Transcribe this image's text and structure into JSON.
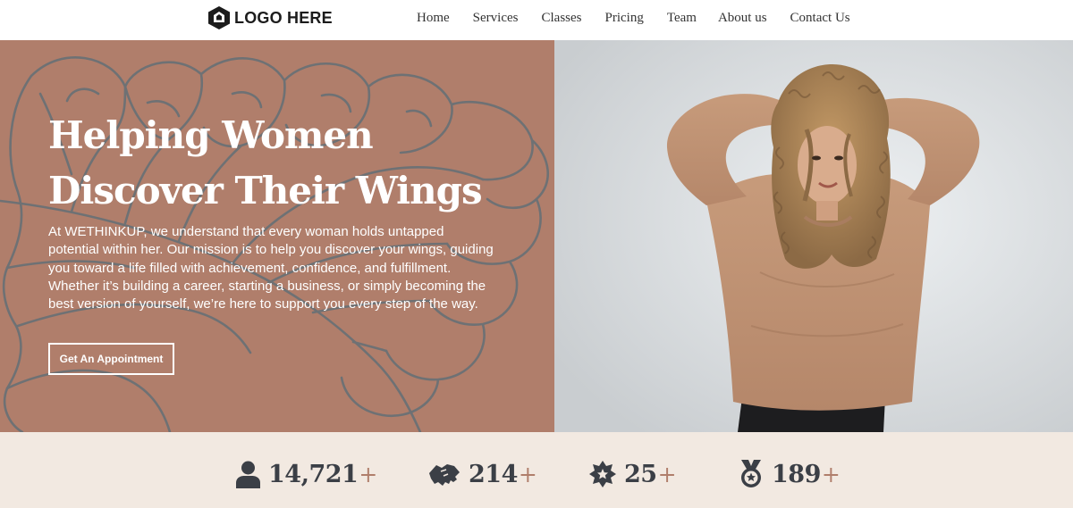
{
  "header": {
    "logo_text": "LOGO HERE",
    "logo_icon": "hexagon-home-icon",
    "nav": [
      "Home",
      "Services",
      "Classes",
      "Pricing",
      "Team",
      "About us",
      "Contact Us"
    ]
  },
  "hero": {
    "title_line1": "Helping Women",
    "title_line2": "Discover Their Wings",
    "description": "At WETHINKUP, we understand that every woman holds untapped potential within her. Our mission is to help you discover your wings, guiding you toward a life filled with achievement, confidence, and fulfillment. Whether it’s building a career, starting a business, or simply becoming the best version of yourself, we’re here to support you every step of the way.",
    "cta_label": "Get An Appointment",
    "photo_alt": "Smiling woman with curly hair in a tan sweater",
    "background_color": "#b07e6b"
  },
  "stats": {
    "plus_symbol": "+",
    "items": [
      {
        "icon": "user-icon",
        "value": "14,721"
      },
      {
        "icon": "handshake-icon",
        "value": "214"
      },
      {
        "icon": "badge-star-icon",
        "value": "25"
      },
      {
        "icon": "medal-icon",
        "value": "189"
      }
    ],
    "background_color": "#f2e9e1",
    "accent_color": "#b07e6b"
  }
}
